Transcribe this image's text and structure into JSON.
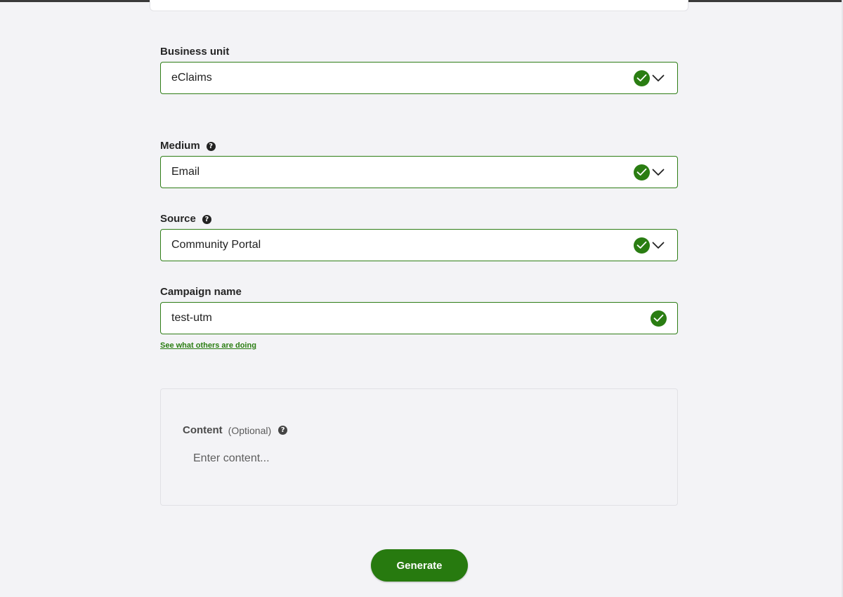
{
  "form": {
    "business_unit": {
      "label": "Business unit",
      "value": "eClaims"
    },
    "medium": {
      "label": "Medium",
      "value": "Email"
    },
    "source": {
      "label": "Source",
      "value": "Community Portal"
    },
    "campaign_name": {
      "label": "Campaign name",
      "value": "test-utm"
    },
    "others_link": "See what others are doing",
    "content": {
      "label": "Content",
      "optional": "(Optional)",
      "placeholder": "Enter content..."
    },
    "generate_label": "Generate"
  },
  "icons": {
    "valid": "check-circle-icon",
    "dropdown": "chevron-down-icon",
    "help": "question-circle-icon"
  },
  "colors": {
    "accent": "#2a7d12",
    "field_border": "#2e7d16",
    "background": "#f3f3f6"
  }
}
